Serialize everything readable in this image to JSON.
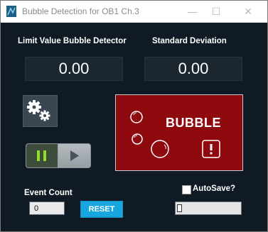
{
  "window": {
    "title": "Bubble Detection for OB1 Ch.3",
    "minimize_symbol": "—",
    "maximize_symbol": "☐",
    "close_symbol": "✕"
  },
  "labels": {
    "limit_value": "Limit Value Bubble Detector",
    "std_dev": "Standard Deviation",
    "event_count": "Event Count",
    "autosave": "AutoSave?"
  },
  "values": {
    "limit_value": "0.00",
    "std_dev": "0.00",
    "event_count": "0"
  },
  "indicator": {
    "text": "BUBBLE",
    "background_color": "#8e0a0f"
  },
  "buttons": {
    "reset": "RESET"
  },
  "icons": {
    "app": "app-icon",
    "settings": "gears-icon",
    "pause": "pause-icon",
    "play": "play-icon",
    "bubbles": "bubbles-icon",
    "warning": "warning-icon",
    "file": "file-icon"
  },
  "colors": {
    "panel_bg": "#0f1a24",
    "accent_blue": "#18a6de",
    "pause_green": "#8fe024"
  }
}
